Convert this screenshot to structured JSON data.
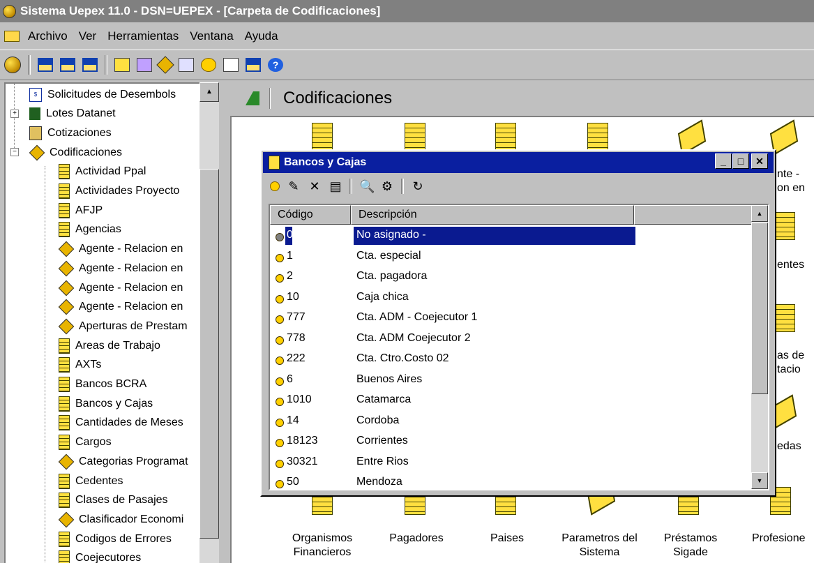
{
  "window": {
    "title": "Sistema Uepex 11.0   - DSN=UEPEX - [Carpeta de Codificaciones]"
  },
  "menu": [
    "Archivo",
    "Ver",
    "Herramientas",
    "Ventana",
    "Ayuda"
  ],
  "tree": {
    "items": [
      {
        "label": "Solicitudes de Desembols",
        "icon": "usd-doc-icon"
      },
      {
        "label": "Lotes Datanet",
        "icon": "grid-icon"
      },
      {
        "label": "Cotizaciones",
        "icon": "tag-icon"
      },
      {
        "label": "Codificaciones",
        "icon": "diamond-icon"
      },
      {
        "label": "Actividad Ppal",
        "icon": "doc-icon"
      },
      {
        "label": "Actividades Proyecto",
        "icon": "doc-icon"
      },
      {
        "label": "AFJP",
        "icon": "doc-icon"
      },
      {
        "label": "Agencias",
        "icon": "doc-icon"
      },
      {
        "label": "Agente - Relacion en",
        "icon": "diamond-icon"
      },
      {
        "label": "Agente - Relacion en",
        "icon": "diamond-icon"
      },
      {
        "label": "Agente - Relacion en",
        "icon": "diamond-icon"
      },
      {
        "label": "Agente - Relacion en",
        "icon": "diamond-icon"
      },
      {
        "label": "Aperturas de Prestam",
        "icon": "diamond-icon"
      },
      {
        "label": "Areas de Trabajo",
        "icon": "doc-icon"
      },
      {
        "label": "AXTs",
        "icon": "doc-icon"
      },
      {
        "label": "Bancos BCRA",
        "icon": "doc-icon"
      },
      {
        "label": "Bancos y Cajas",
        "icon": "doc-icon"
      },
      {
        "label": "Cantidades de Meses",
        "icon": "doc-icon"
      },
      {
        "label": "Cargos",
        "icon": "doc-icon"
      },
      {
        "label": "Categorias Programat",
        "icon": "diamond-icon"
      },
      {
        "label": "Cedentes",
        "icon": "doc-icon"
      },
      {
        "label": "Clases de Pasajes",
        "icon": "doc-icon"
      },
      {
        "label": "Clasificador Economi",
        "icon": "diamond-icon"
      },
      {
        "label": "Codigos de Errores",
        "icon": "doc-icon"
      },
      {
        "label": "Coejecutores",
        "icon": "doc-icon"
      }
    ]
  },
  "content": {
    "heading": "Codificaciones",
    "right_partial": [
      "nte -",
      "on en",
      "entes",
      "as de",
      "tacio",
      "edas"
    ],
    "bottom_labels": [
      {
        "line1": "Organismos",
        "line2": "Financieros"
      },
      {
        "line1": "Pagadores",
        "line2": ""
      },
      {
        "line1": "Paises",
        "line2": ""
      },
      {
        "line1": "Parametros del",
        "line2": "Sistema"
      },
      {
        "line1": "Préstamos",
        "line2": "Sigade"
      },
      {
        "line1": "Profesione",
        "line2": ""
      }
    ]
  },
  "dialog": {
    "title": "Bancos y Cajas",
    "columns": [
      "Código",
      "Descripción"
    ],
    "rows": [
      {
        "code": "0",
        "desc": "No asignado -"
      },
      {
        "code": "1",
        "desc": "Cta. especial"
      },
      {
        "code": "2",
        "desc": "Cta. pagadora"
      },
      {
        "code": "10",
        "desc": "Caja chica"
      },
      {
        "code": "777",
        "desc": "Cta. ADM - Coejecutor 1"
      },
      {
        "code": "778",
        "desc": "Cta. ADM Coejecutor 2"
      },
      {
        "code": "222",
        "desc": "Cta. Ctro.Costo 02"
      },
      {
        "code": "6",
        "desc": "Buenos Aires"
      },
      {
        "code": "1010",
        "desc": "Catamarca"
      },
      {
        "code": "14",
        "desc": "Cordoba"
      },
      {
        "code": "18123",
        "desc": "Corrientes"
      },
      {
        "code": "30321",
        "desc": "Entre Rios"
      },
      {
        "code": "50",
        "desc": "Mendoza"
      }
    ]
  }
}
